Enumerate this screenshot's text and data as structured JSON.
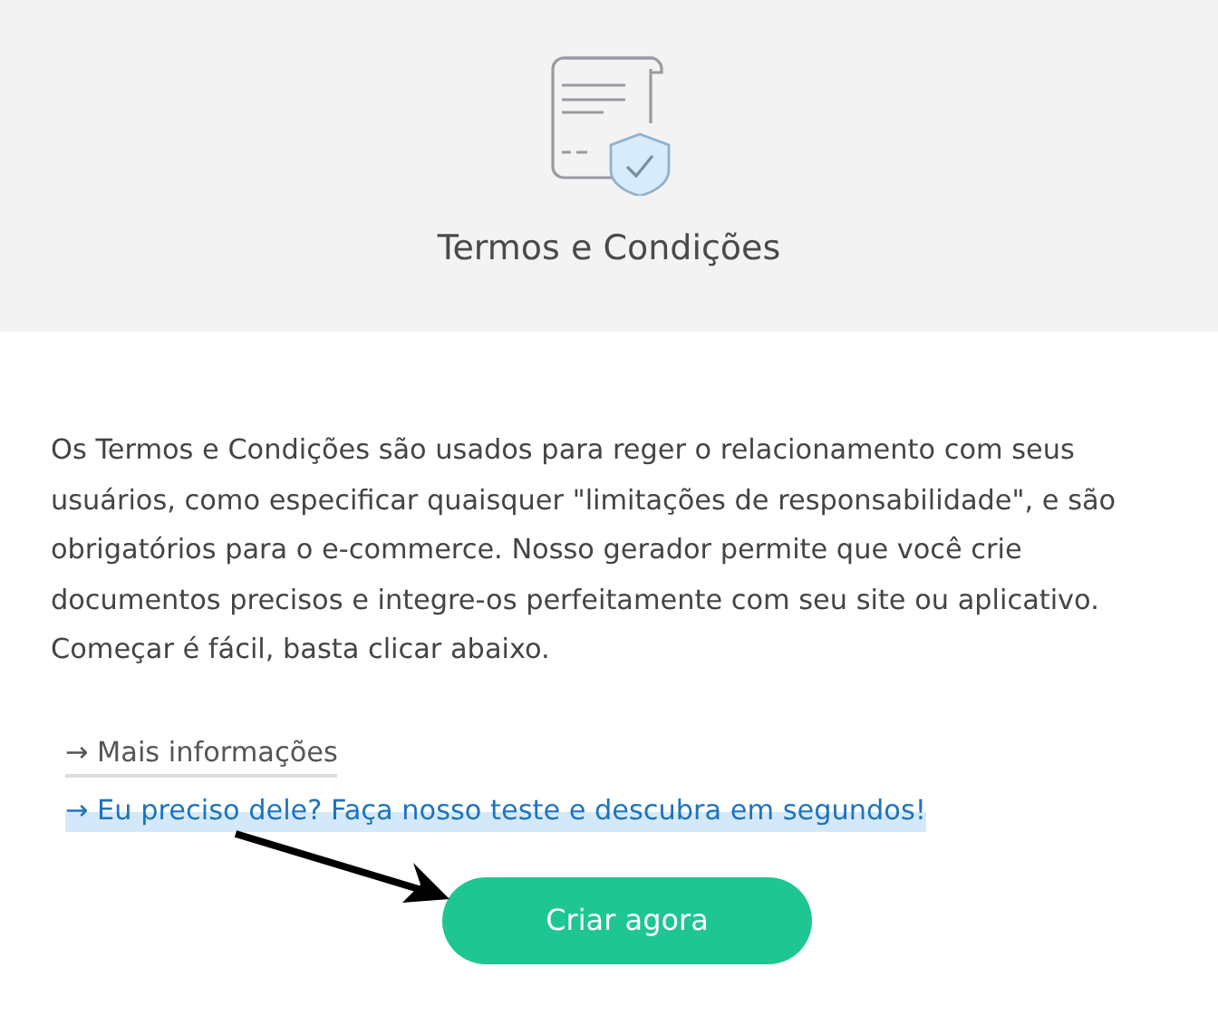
{
  "header": {
    "title": "Termos e Condições"
  },
  "description": "Os Termos e Condições são usados para reger o relacionamento com seus usuários, como especificar quaisquer \"limitações de responsabilidade\", e são obrigatórios para o e-commerce. Nosso gerador permite que você crie documentos precisos e integre-os perfeitamente com seu site ou aplicativo. Começar é fácil, basta clicar abaixo.",
  "links": [
    {
      "kind": "plain",
      "arrow": "→",
      "label": "Mais informações"
    },
    {
      "kind": "highlighted",
      "arrow": "→",
      "label": "Eu preciso dele? Faça nosso teste e descubra em segundos!"
    }
  ],
  "button": {
    "label": "Criar agora"
  }
}
